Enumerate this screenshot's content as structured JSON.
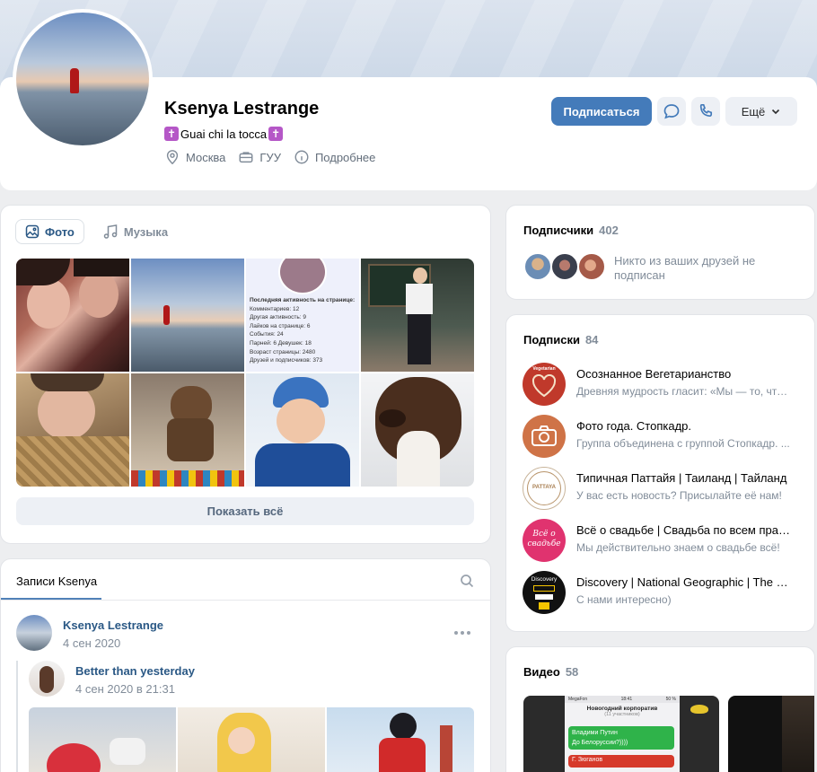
{
  "profile": {
    "name": "Ksenya Lestrange",
    "status_text": "Guai chi la tocca",
    "status_emoji": "✝",
    "city": "Москва",
    "education": "ГУУ",
    "more_info": "Подробнее"
  },
  "actions": {
    "subscribe": "Подписаться",
    "more": "Ещё"
  },
  "media": {
    "tabs": [
      {
        "label": "Фото",
        "active": true
      },
      {
        "label": "Музыка",
        "active": false
      }
    ],
    "show_all": "Показать всё",
    "stats_photo": {
      "title": "Последняя активность на странице:",
      "lines": [
        "Комментариев: 12",
        "Другая активность: 9",
        "Лайков на странице: 6",
        "События: 24",
        "Парней: 6  Девушек: 18",
        "Возраст страницы: 2480",
        "Друзей и подписчиков: 373"
      ]
    }
  },
  "followers": {
    "title": "Подписчики",
    "count": "402",
    "note": "Никто из ваших друзей не подписан"
  },
  "subscriptions": {
    "title": "Подписки",
    "count": "84",
    "items": [
      {
        "name": "Осознанное Вегетарианство",
        "desc": "Древняя мудрость гласит: «Мы — то, что ...",
        "icon": "heart-icon",
        "label": "Vegetarian"
      },
      {
        "name": "Фото года. Стопкадр.",
        "desc": "Группа объединена с группой Стопкадр. ...",
        "icon": "camera-icon",
        "label": ""
      },
      {
        "name": "Типичная Паттайя | Таиланд | Тайланд",
        "desc": "У вас есть новость? Присылайте её нам!",
        "icon": "pattaya-logo",
        "label": "PATTAYA"
      },
      {
        "name": "Всё о свадьбе | Свадьба по всем прав...",
        "desc": "Мы действительно знаем о свадьбе всё!",
        "icon": "wedding-logo",
        "label": "Всё о свадьбе"
      },
      {
        "name": "Discovery | National Geographic | The Gr...",
        "desc": "С нами интересно)",
        "icon": "discovery-logo",
        "label": "Discovery"
      }
    ]
  },
  "videos": {
    "title": "Видео",
    "count": "58",
    "chat_preview": {
      "carrier": "MegaFon",
      "time": "18:41",
      "battery": "50 %",
      "chat_title": "Новогодний корпоратив",
      "participants": "(11 участников)",
      "msg_author": "Владими Путин",
      "msg_text": "До Белоруссии?))))",
      "msg_author2": "Г. Зюганов"
    }
  },
  "wall": {
    "tab": "Записи Ksenya",
    "post": {
      "author": "Ksenya Lestrange",
      "date": "4 сен 2020",
      "repost_author": "Better than yesterday",
      "repost_date": "4 сен 2020 в 21:31"
    }
  },
  "colors": {
    "accent": "#447bba",
    "link": "#2a5885",
    "muted": "#818c99"
  }
}
